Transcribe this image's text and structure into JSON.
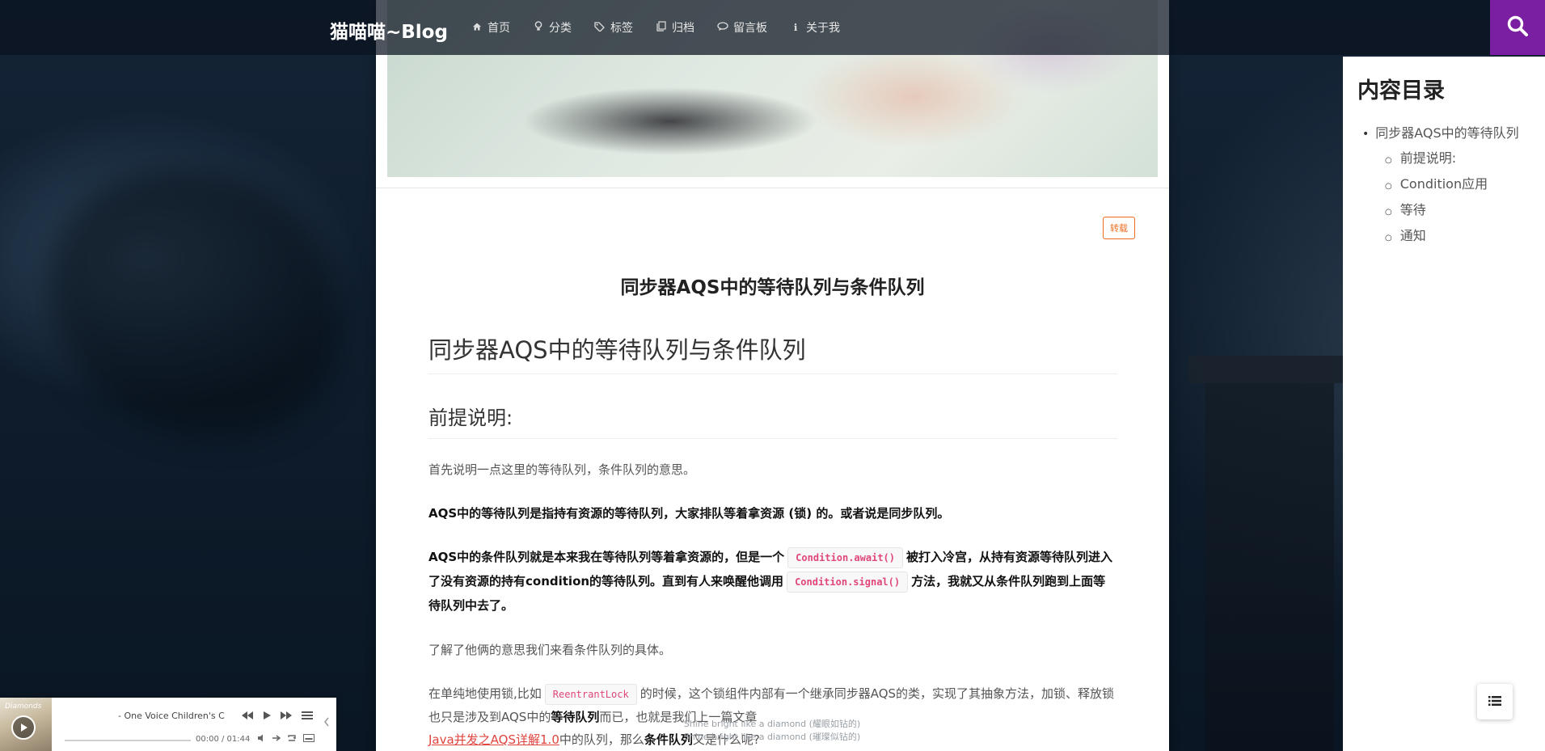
{
  "brand": "猫喵喵~Blog",
  "nav": [
    {
      "icon": "home-icon",
      "label": "首页"
    },
    {
      "icon": "lightbulb-icon",
      "label": "分类"
    },
    {
      "icon": "tags-icon",
      "label": "标签"
    },
    {
      "icon": "archive-icon",
      "label": "归档"
    },
    {
      "icon": "comments-icon",
      "label": "留言板"
    },
    {
      "icon": "info-icon",
      "label": "关于我"
    }
  ],
  "colors": {
    "accent": "#7b1fa2",
    "badge": "#f06b1f",
    "link": "#e0443e",
    "code": "#e0467c"
  },
  "post": {
    "badge": "转载",
    "title": "同步器AQS中的等待队列与条件队列",
    "h1": "同步器AQS中的等待队列与条件队列",
    "h2": "前提说明:",
    "p1": "首先说明一点这里的等待队列，条件队列的意思。",
    "p2": "AQS中的等待队列是指持有资源的等待队列，大家排队等着拿资源 (锁) 的。或者说是同步队列。",
    "p3_a": "AQS中的条件队列就是本来我在等待队列等着拿资源的，但是一个",
    "p3_code1": "Condition.await()",
    "p3_b": "被打入冷宫，从持有资源等待队列进入了没有资源的持有condition的等待队列。直到有人来唤醒他调用",
    "p3_code2": "Condition.signal()",
    "p3_c": "方法，我就又从条件队列跑到上面等待队列中去了。",
    "p4": "了解了他俩的意思我们来看条件队列的具体。",
    "p5_a": "在单纯地使用锁,比如",
    "p5_code": "ReentrantLock",
    "p5_b": "的时候，这个锁组件内部有一个继承同步器AQS的类，实现了其抽象方法，加锁、释放锁也只是涉及到AQS中的",
    "p5_bold1": "等待队列",
    "p5_c": "而已，也就是我们上一篇文章",
    "p5_link": "Java并发之AQS详解1.0",
    "p5_d": "中的队列，那么",
    "p5_bold2": "条件队列",
    "p5_e": "又是什么呢?"
  },
  "lyrics": {
    "line1": "Shine bright like a diamond (耀眼如钻的)",
    "line2": "Shine bright like a diamond (璀璨似钻的)"
  },
  "toc": {
    "title": "内容目录",
    "root": "同步器AQS中的等待队列",
    "items": [
      "前提说明:",
      "Condition应用",
      "等待",
      "通知"
    ]
  },
  "player": {
    "cover_text": "Diamonds",
    "song": "- One Voice Children's C",
    "time": "00:00 / 01:44",
    "progress": 0.0
  }
}
